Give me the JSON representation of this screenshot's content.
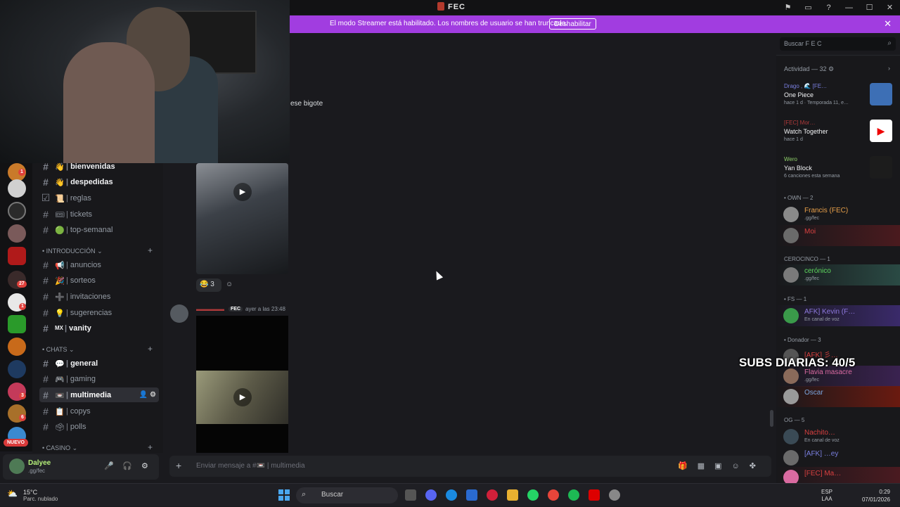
{
  "window": {
    "title": "FEC",
    "controls": [
      "⚑",
      "▭",
      "?",
      "—",
      "☐",
      "✕"
    ]
  },
  "banner": {
    "text": "El modo Streamer está habilitado. Los nombres de usuario se han truncado.",
    "button": "Deshabilitar",
    "close": "✕"
  },
  "servers": {
    "badges": [
      "1",
      "27",
      "1",
      "3",
      "6"
    ],
    "new_label": "NUEVO"
  },
  "channels": {
    "items": [
      {
        "emoji": "👋",
        "name": "bienvenidas",
        "bold": true
      },
      {
        "emoji": "👋",
        "name": "despedidas",
        "bold": true
      },
      {
        "emoji": "📜",
        "name": "reglas"
      },
      {
        "emoji": "🎟",
        "name": "tickets"
      },
      {
        "emoji": "🟢",
        "name": "top-semanal"
      }
    ],
    "cat_intro": "• INTRODUCCIÓN",
    "intro_items": [
      {
        "emoji": "📢",
        "name": "anuncios"
      },
      {
        "emoji": "🎉",
        "name": "sorteos"
      },
      {
        "emoji": "➕",
        "name": "invitaciones"
      },
      {
        "emoji": "💡",
        "name": "sugerencias"
      },
      {
        "emoji": "MX",
        "name": "vanity",
        "bold": true
      }
    ],
    "cat_chats": "• CHATS",
    "chat_items": [
      {
        "emoji": "💬",
        "name": "general",
        "bold": true
      },
      {
        "emoji": "🎮",
        "name": "gaming"
      },
      {
        "emoji": "📼",
        "name": "multimedia",
        "active": true
      },
      {
        "emoji": "📋",
        "name": "copys"
      },
      {
        "emoji": "🗳",
        "name": "polls"
      }
    ],
    "cat_casino": "• CASINO"
  },
  "user": {
    "name": "Dalyee",
    "status": ".gg/fec"
  },
  "messages": {
    "text1": "ese bigote",
    "reaction_count": "3",
    "msg2_tag": "FEC",
    "msg2_time": "ayer a las 23:48"
  },
  "composer": {
    "placeholder": "Enviar mensaje a #📼 | multimedia"
  },
  "search": {
    "placeholder": "Buscar F E C"
  },
  "members": {
    "activity_header": "Actividad — 32",
    "activities": [
      {
        "who": "Drago , 🌊 [FE…",
        "what": "One Piece",
        "detail": "hace 1 d · Temporada 11, e…",
        "thumb_color": "#3d6fb5"
      },
      {
        "who": "[FEC] Mor…",
        "what": "Watch Together",
        "detail": "hace 1 d",
        "thumb_color": "#ffffff"
      },
      {
        "who": "Wero",
        "what": "Yan Block",
        "detail": "6 canciones esta semana",
        "thumb_color": "#1c1c1c"
      }
    ],
    "groups": [
      {
        "label": "• OWN — 2",
        "members": [
          {
            "name": "Francis (FEC)",
            "tag": "FEC",
            "status": ".gg/fec",
            "color": "#e8a04a"
          },
          {
            "name": "Moi",
            "tag": "FEC",
            "status": "",
            "color": "#d94040"
          }
        ]
      },
      {
        "label": "CEROCINCO — 1",
        "members": [
          {
            "name": "cerónico",
            "tag": "FEC",
            "status": ".gg/fec",
            "color": "#5fd85f"
          }
        ]
      },
      {
        "label": "• FS — 1",
        "members": [
          {
            "name": "AFK] Kevin (F…",
            "tag": "FEC",
            "status": "En canal de voz",
            "color": "#8f7ae0"
          }
        ]
      },
      {
        "label": "• Donador — 3",
        "members": [
          {
            "name": "[AFK] 彡…",
            "tag": "FEC",
            "status": "",
            "color": "#d94040"
          },
          {
            "name": "Flavia masacre",
            "tag": "FEC",
            "status": ".gg/fec",
            "color": "#d96aa0"
          },
          {
            "name": "Oscar",
            "tag": "",
            "status": "",
            "color": "#7aa6e0"
          }
        ]
      },
      {
        "label": "OG — 5",
        "members": [
          {
            "name": "Nachito…",
            "tag": "FEC",
            "status": "En canal de voz",
            "color": "#d94040"
          },
          {
            "name": "[AFK] …ey",
            "tag": "Gve",
            "status": "",
            "color": "#7a7fe0"
          },
          {
            "name": "[FEC] Ma…",
            "tag": "FEC",
            "status": ".gg/fec",
            "color": "#d94040"
          }
        ]
      }
    ]
  },
  "overlay": {
    "subs": "SUBS DIARIAS: 40/5"
  },
  "taskbar": {
    "temp": "15°C",
    "weather": "Parc. nublado",
    "search": "Buscar",
    "lang1": "ESP",
    "lang2": "LAA",
    "time": "0:29",
    "date": "07/01/2026"
  }
}
